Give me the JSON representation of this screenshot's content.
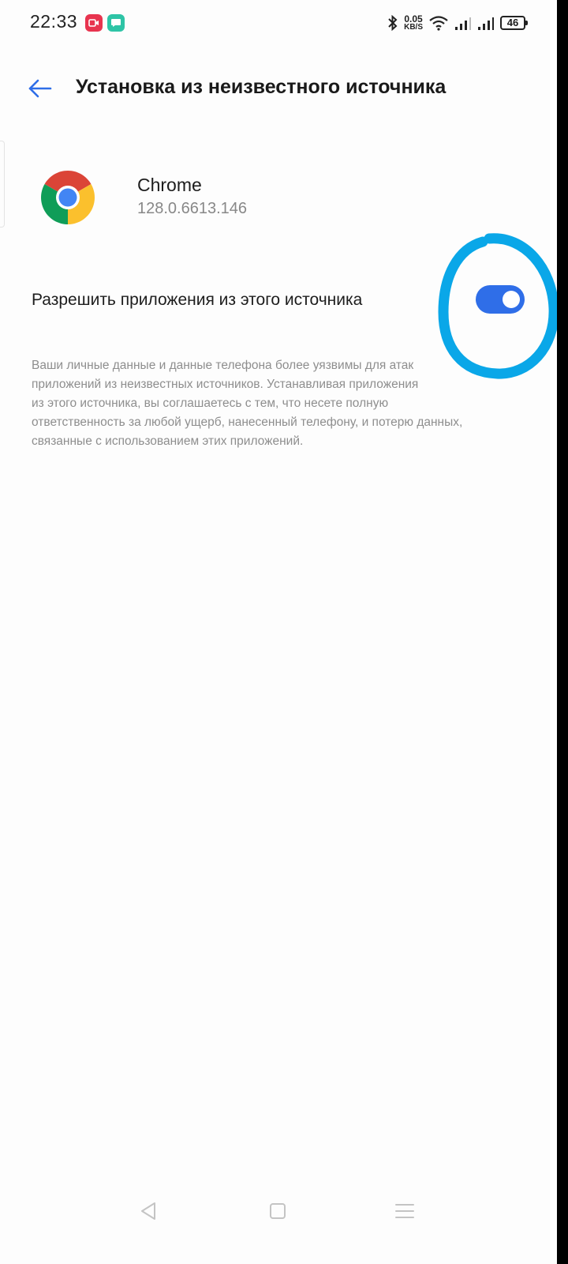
{
  "status_bar": {
    "time": "22:33",
    "net_speed_value": "0.05",
    "net_speed_unit": "KB/S",
    "battery_level": "46",
    "icons": [
      "screen-record-icon",
      "message-app-icon",
      "bluetooth-icon",
      "wifi-icon",
      "signal-sim1-icon",
      "signal-sim2-icon",
      "battery-icon"
    ]
  },
  "header": {
    "title": "Установка из неизвестного источника",
    "back_icon": "arrow-left-icon"
  },
  "app": {
    "name": "Chrome",
    "version": "128.0.6613.146",
    "icon": "chrome-icon"
  },
  "setting": {
    "label": "Разрешить приложения из этого источника",
    "enabled": true,
    "accent_color": "#2f6ee8"
  },
  "warning": {
    "lines": [
      "Ваши личные данные и данные телефона более уязвимы для атак",
      "приложений из неизвестных источников. Устанавливая приложения",
      "из этого источника, вы соглашаетесь с тем, что несете полную",
      "ответственность за любой ущерб, нанесенный телефону, и потерю данных,",
      "связанные с использованием этих приложений."
    ]
  },
  "annotation": {
    "color": "#0aa7e8",
    "shape": "hand-drawn-circle"
  },
  "nav_bar": {
    "buttons": [
      "nav-back-icon",
      "nav-home-icon",
      "nav-recents-icon"
    ]
  }
}
